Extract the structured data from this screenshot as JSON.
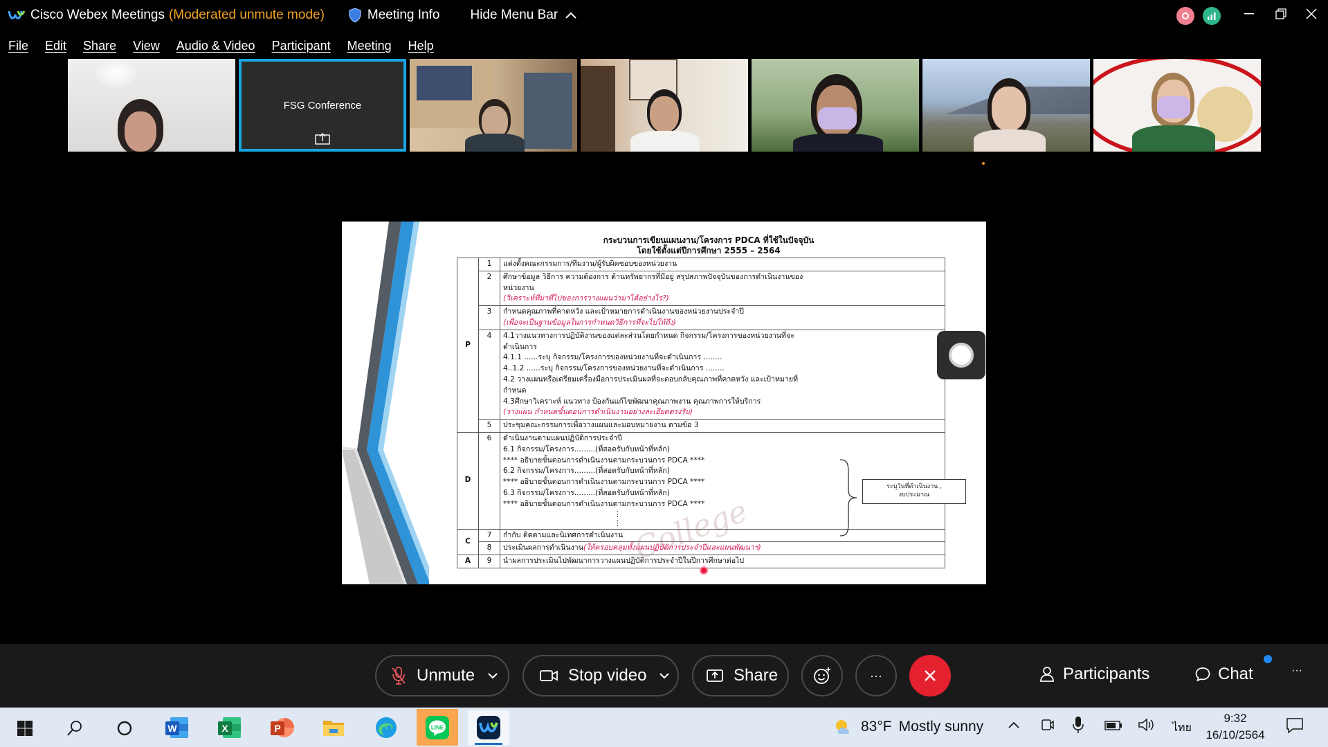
{
  "titlebar": {
    "app_title": "Cisco Webex Meetings",
    "mode": "(Moderated unmute mode)",
    "meeting_info": "Meeting Info",
    "hide_menu": "Hide Menu Bar"
  },
  "menu": [
    "File",
    "Edit",
    "Share",
    "View",
    "Audio & Video",
    "Participant",
    "Meeting",
    "Help"
  ],
  "participants_strip": {
    "fsg_label": "FSG Conference"
  },
  "document": {
    "title_line1": "กระบวนการเขียนแผนงาน/โครงการ PDCA ที่ใช้ในปัจจุบัน",
    "title_line2": "โดยใช้ตั้งแต่ปีการศึกษา 2555 – 2564",
    "rows": [
      {
        "phase": "P",
        "num": "1",
        "lines": [
          "แต่งตั้งคณะกรรมการ/ทีมงาน/ผู้รับผิดชอบของหน่วยงาน"
        ],
        "red": ""
      },
      {
        "phase": "",
        "num": "2",
        "lines": [
          "ศึกษาข้อมูล วิธีการ ความต้องการ ด้านทรัพยากรที่มีอยู่ สรุปสภาพปัจจุบันของการดำเนินงานของ",
          "หน่วยงาน"
        ],
        "red": "(วิเคราะห์ที่มาที่ไปของการวางแผนว่ามาได้อย่างไร?)"
      },
      {
        "phase": "",
        "num": "3",
        "lines": [
          "กำหนดคุณภาพที่คาดหวัง และเป้าหมายการดำเนินงานของหน่วยงานประจำปี"
        ],
        "red": "(เพื่อจะเป็นฐานข้อมูลในการกำหนดวิธีการที่จะไปให้ถึง)"
      },
      {
        "phase": "",
        "num": "4",
        "lines": [
          "4.1วางแนวทางการปฏิบัติงานของแต่ละส่วนโดยกำหนด กิจกรรม/โครงการของหน่วยงานที่จะ",
          "ดำเนินการ",
          "4.1.1 ......ระบุ กิจกรรม/โครงการของหน่วยงานที่จะดำเนินการ ........",
          "4..1.2 ......ระบุ กิจกรรม/โครงการของหน่วยงานที่จะดำเนินการ ........",
          "4.2 วางแผนหรือเตรียมเครื่องมือการประเมินผลที่จะตอบกลับคุณภาพที่คาดหวัง และเป้าหมายที่",
          "กำหนด",
          "4.3ศึกษาวิเคราะห์ แนวทาง ป้องกันแก้ไขพัฒนาคุณภาพงาน คุณภาพการให้บริการ"
        ],
        "red": "(วางแผน กำหนดขั้นตอนการดำเนินงานอย่างละเอียดตรงรับ)"
      },
      {
        "phase": "",
        "num": "5",
        "lines": [
          "ประชุมคณะกรรมการเพื่อวางแผนและมอบหมายงาน ตามข้อ 3"
        ],
        "red": ""
      },
      {
        "phase": "D",
        "num": "6",
        "lines": [
          "ดำเนินงานตามแผนปฏิบัติการประจำปี",
          "6.1  กิจกรรม/โครงการ.........(ที่สอดรับกับหน้าที่หลัก)",
          "**** อธิบายขั้นตอนการดำเนินงานตามกระบวนการ PDCA ****",
          "6.2  กิจกรรม/โครงการ.........(ที่สอดรับกับหน้าที่หลัก)",
          "**** อธิบายขั้นตอนการดำเนินงานตามกระบวนการ PDCA ****",
          "6.3  กิจกรรม/โครงการ.........(ที่สอดรับกับหน้าที่หลัก)",
          "**** อธิบายขั้นตอนการดำเนินงานตามกระบวนการ PDCA ****",
          "⋮",
          "⋮"
        ],
        "red": ""
      },
      {
        "phase": "C",
        "num": "7",
        "lines": [
          "กำกับ ติดตามและนิเทศการดำเนินงาน"
        ],
        "red": ""
      },
      {
        "phase": "",
        "num": "8",
        "lines": [
          "ประเมินผลการดำเนินงาน"
        ],
        "red": "(ให้ครอบคลุมทั้งแผนปฏิบัติการประจำปีและแผนพัฒนาฯ)"
      },
      {
        "phase": "A",
        "num": "9",
        "lines": [
          "นำผลการประเมินไปพัฒนาการวางแผนปฏิบัติการประจำปีในปีการศึกษาต่อไป"
        ],
        "red": ""
      }
    ],
    "callout_line1": "ระบุวันที่ดำเนินงาน ,",
    "callout_line2": "งบประมาณ",
    "watermark": "College"
  },
  "controls": {
    "unmute": "Unmute",
    "stop_video": "Stop video",
    "share": "Share",
    "more": "···",
    "participants": "Participants",
    "chat": "Chat",
    "overflow": "···"
  },
  "taskbar": {
    "weather_temp": "83°F",
    "weather_text": "Mostly sunny",
    "lang": "ไทย",
    "time": "9:32",
    "date": "16/10/2564"
  },
  "colors": {
    "accent_orange": "#f2a424",
    "active_tile_border": "#17a6e0",
    "end_call": "#e5212f",
    "annotation_red": "#d2185a"
  }
}
